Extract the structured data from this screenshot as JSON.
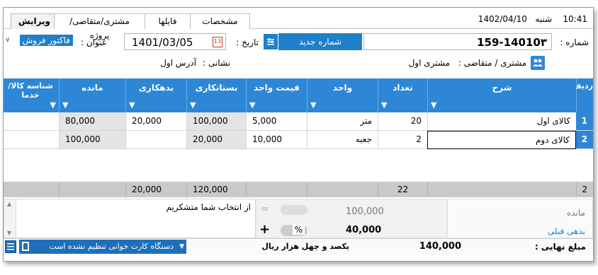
{
  "status_bar": {
    "time": "10:41",
    "day": "شنبه",
    "date": "1402/04/10"
  },
  "tabs": [
    {
      "label": "ویرایش",
      "active": true
    },
    {
      "label": "مشتری/متقاضی/پروژه"
    },
    {
      "label": "فایلها"
    },
    {
      "label": "مشخصات"
    }
  ],
  "header": {
    "number_label": "شماره :",
    "number_value": "14010٣-159",
    "new_number_button": "شماره جدید",
    "date_label": "تاریخ :",
    "date_value": "1401/03/05",
    "title_label": "عنوان :",
    "title_value": "فاکتور فروش",
    "customer_label": "مشتری / متقاضی :",
    "customer_value": "مشتری اول",
    "address_label": "نشانی :",
    "address_value": "آدرس اول"
  },
  "grid": {
    "columns": [
      "ردیف",
      "شرح",
      "تعداد",
      "واحد",
      "قیمت واحد",
      "بستانکاری",
      "بدهکاری",
      "مانده",
      "شناسه کالا/خدما"
    ],
    "rows": [
      {
        "num": "1",
        "desc": "کالای اول",
        "qty": "20",
        "unit": "متر",
        "price": "5,000",
        "credit": "100,000",
        "debit": "20,000",
        "balance": "80,000",
        "code": ""
      },
      {
        "num": "2",
        "desc": "کالای دوم",
        "qty": "2",
        "unit": "جعبه",
        "price": "10,000",
        "credit": "20,000",
        "debit": "",
        "balance": "100,000",
        "code": ""
      }
    ],
    "footer": {
      "count": "2",
      "qty_total": "22",
      "credit_total": "120,000",
      "debit_total": "20,000"
    }
  },
  "summary": {
    "remaining_label": "مانده",
    "previous_debt_link": "بدهی قبلی",
    "amount_1": "100,000",
    "amount_2": "40,000",
    "percent_sign": "%",
    "equals_sign": "=",
    "plus_sign": "+",
    "note_text": "از انتخاب شما متشکریم"
  },
  "footer_bar": {
    "final_amount_label": "مبلغ نهایی :",
    "final_amount_value": "140,000",
    "amount_in_words": "یکصد و چهل هزار ریال",
    "card_reader_status": "دستگاه کارت خوانی تنظیم نشده است"
  },
  "colors": {
    "accent": "#2d87d6",
    "grey_cell": "#e4e4e4",
    "sum_row": "#c9c9c9"
  }
}
